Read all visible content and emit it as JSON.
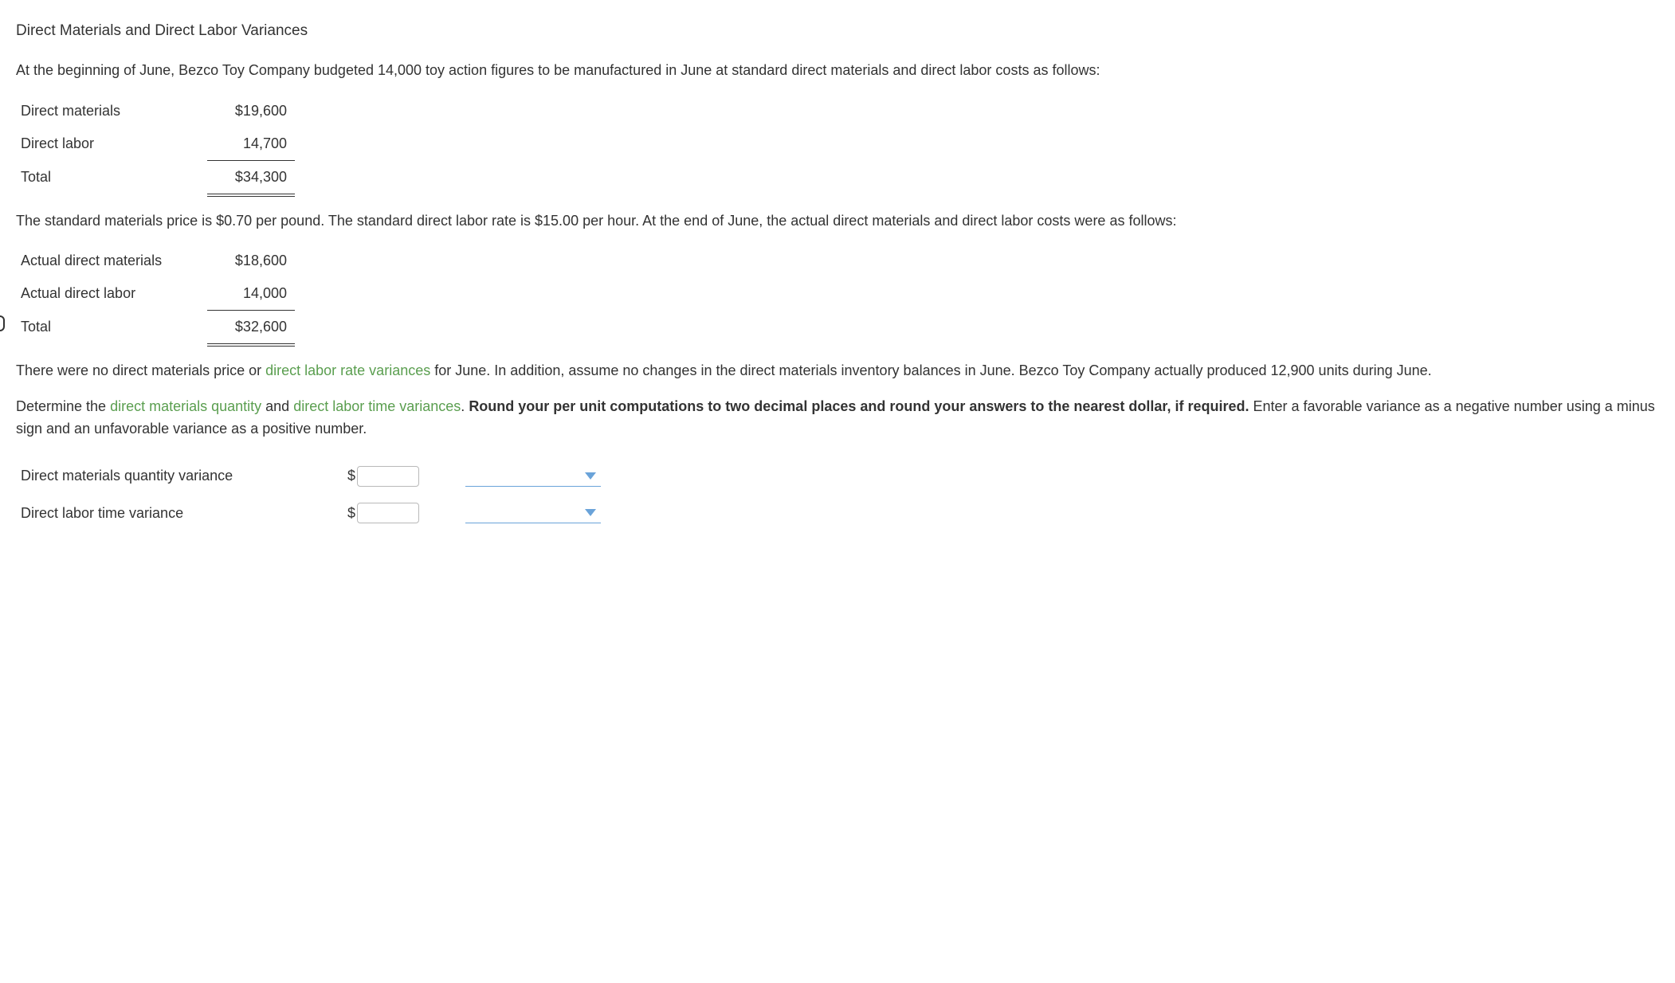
{
  "title": "Direct Materials and Direct Labor Variances",
  "intro": "At the beginning of June, Bezco Toy Company budgeted 14,000 toy action figures to be manufactured in June at standard direct materials and direct labor costs as follows:",
  "budget_table": {
    "rows": [
      {
        "label": "Direct materials",
        "value": "$19,600"
      },
      {
        "label": "Direct labor",
        "value": "14,700"
      },
      {
        "label": "Total",
        "value": "$34,300"
      }
    ]
  },
  "mid_text": "The standard materials price is $0.70 per pound. The standard direct labor rate is $15.00 per hour. At the end of June, the actual direct materials and direct labor costs were as follows:",
  "actual_table": {
    "rows": [
      {
        "label": "Actual direct materials",
        "value": "$18,600"
      },
      {
        "label": "Actual direct labor",
        "value": "14,000"
      },
      {
        "label": "Total",
        "value": "$32,600"
      }
    ]
  },
  "para3_part1": "There were no direct materials price or ",
  "para3_link": "direct labor rate variances",
  "para3_part2": " for June. In addition, assume no changes in the direct materials inventory balances in June. Bezco Toy Company actually produced 12,900 units during June.",
  "para4_part1": "Determine the ",
  "para4_link1": "direct materials quantity",
  "para4_mid": " and ",
  "para4_link2": "direct labor time variances",
  "para4_part2": ". ",
  "para4_bold": "Round your per unit computations to two decimal places and round your answers to the nearest dollar, if required.",
  "para4_part3": " Enter a favorable variance as a negative number using a minus sign and an unfavorable variance as a positive number.",
  "answers": {
    "rows": [
      {
        "label": "Direct materials quantity variance"
      },
      {
        "label": "Direct labor time variance"
      }
    ],
    "currency": "$"
  }
}
